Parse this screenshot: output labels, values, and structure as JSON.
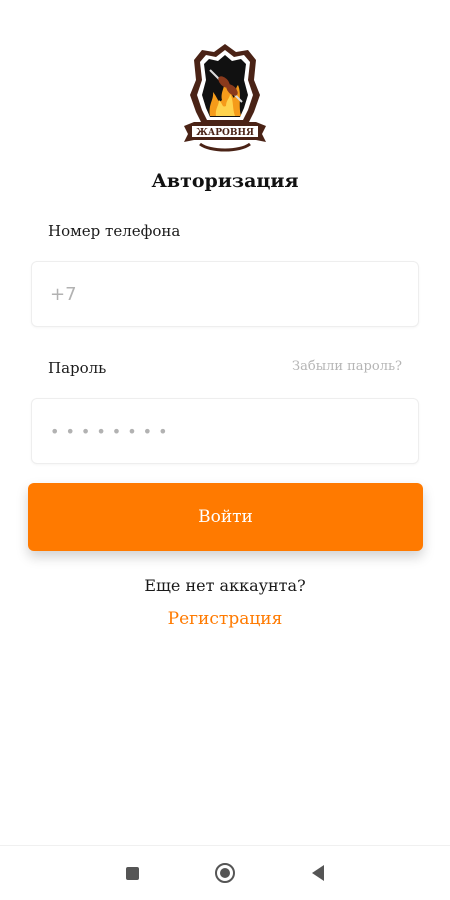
{
  "brand": {
    "logo_text": "ЖАРОВНЯ",
    "logo_icon": "flame-shield-logo",
    "colors": {
      "accent": "#ff7a00",
      "logo_dark": "#4a2316",
      "logo_flame": "#f59b1a"
    }
  },
  "auth": {
    "title": "Авторизация",
    "phone": {
      "label": "Номер телефона",
      "placeholder": "+7",
      "value": ""
    },
    "password": {
      "label": "Пароль",
      "forgot_link": "Забыли пароль?",
      "placeholder": "••••••••",
      "value": ""
    },
    "login_button": "Войти",
    "no_account_text": "Еще нет аккаунта?",
    "register_link": "Регистрация"
  },
  "system_nav": {
    "recents_icon": "square-icon",
    "home_icon": "circle-icon",
    "back_icon": "triangle-back-icon"
  }
}
